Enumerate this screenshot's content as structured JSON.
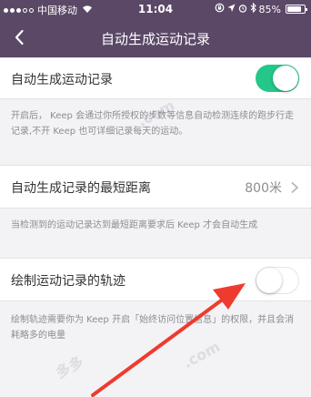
{
  "status_bar": {
    "carrier": "中国移动",
    "time": "11:04",
    "battery": "85%",
    "battery_level": 0.85
  },
  "nav": {
    "title": "自动生成运动记录"
  },
  "settings": [
    {
      "label": "自动生成运动记录",
      "toggle": "on",
      "description": "开启后， Keep 会通过你所授权的步数等信息自动检测连续的跑步行走记录,不开 Keep 也可详细记录每天的运动。"
    },
    {
      "label": "自动生成记录的最短距离",
      "value": "800米",
      "description": "当检测到的运动记录达到最短距离要求后 Keep 才会自动生成"
    },
    {
      "label": "绘制运动记录的轨迹",
      "toggle": "off",
      "description": "绘制轨迹需要你为 Keep 开启「始终访问位置信息」的权限，并且会消耗略多的电量"
    }
  ],
  "colors": {
    "header": "#5b4867",
    "toggle_on": "#24c789",
    "annotation_arrow": "#ee3b2f"
  }
}
